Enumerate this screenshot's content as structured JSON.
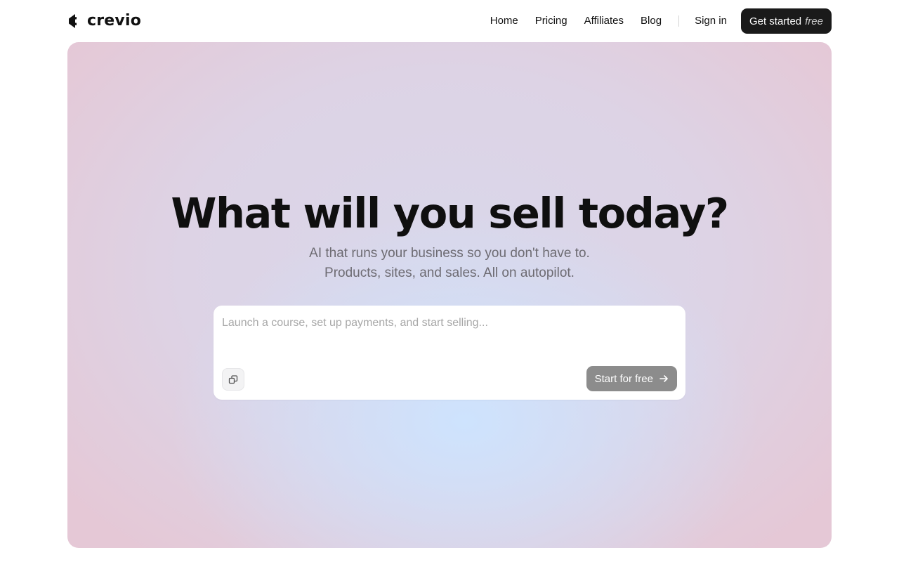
{
  "brand": {
    "name": "crevio",
    "logo_icon": "crevio-logo-icon"
  },
  "nav": {
    "links": [
      "Home",
      "Pricing",
      "Affiliates",
      "Blog"
    ],
    "sign_in": "Sign in",
    "cta_label": "Get started",
    "cta_emphasis": "free"
  },
  "hero": {
    "headline": "What will you sell today?",
    "subline_1": "AI that runs your business so you don't have to.",
    "subline_2": "Products, sites, and sales. All on autopilot.",
    "prompt": {
      "value": "",
      "placeholder": "Launch a course, set up payments, and start selling...",
      "attach_icon": "attach-icon",
      "submit_label": "Start for free",
      "submit_icon": "arrow-right-icon"
    }
  },
  "colors": {
    "cta_background": "#1a1a1a",
    "submit_background": "#8c8c8c",
    "hero_gradient_edge": "#e5c8d6",
    "hero_gradient_center": "#d9d7ea",
    "hero_glow": "#cde4ff"
  }
}
